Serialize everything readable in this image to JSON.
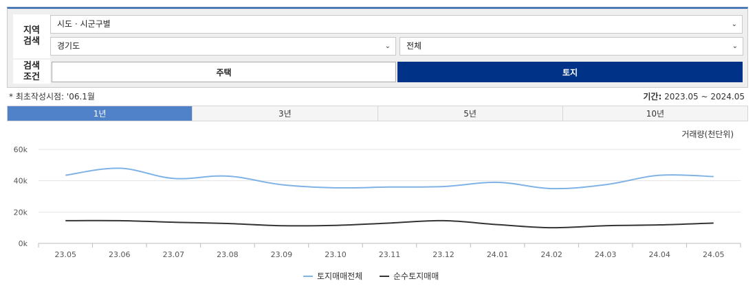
{
  "search": {
    "region_label": "지역\n검색",
    "condition_label": "검색\n조건",
    "mode_select": "시도 · 시군구별",
    "province_select": "경기도",
    "city_select": "전체",
    "btn_house": "주택",
    "btn_land": "토지"
  },
  "info": {
    "note": "* 최초작성시점: '06.1월",
    "period_label": "기간:",
    "period_value": " 2023.05 ~ 2024.05"
  },
  "tabs": [
    {
      "label": "1년",
      "active": true
    },
    {
      "label": "3년",
      "active": false
    },
    {
      "label": "5년",
      "active": false
    },
    {
      "label": "10년",
      "active": false
    }
  ],
  "colors": {
    "accent": "#003388",
    "tab_active": "#4f82c9",
    "series1": "#7fb2e5",
    "series2": "#333333"
  },
  "chart_data": {
    "type": "line",
    "ylabel": "거래량(천단위)",
    "ylim": [
      0,
      60000
    ],
    "y_ticks": [
      0,
      20000,
      40000,
      60000
    ],
    "y_tick_labels": [
      "0k",
      "20k",
      "40k",
      "60k"
    ],
    "categories": [
      "23.05",
      "23.06",
      "23.07",
      "23.08",
      "23.09",
      "23.10",
      "23.11",
      "23.12",
      "24.01",
      "24.02",
      "24.03",
      "24.04",
      "24.05"
    ],
    "series": [
      {
        "name": "토지매매전체",
        "values": [
          43500,
          48000,
          41500,
          43000,
          37500,
          35500,
          36000,
          36300,
          39000,
          35000,
          37500,
          43500,
          42700
        ]
      },
      {
        "name": "순수토지매매",
        "values": [
          14500,
          14500,
          13500,
          12700,
          11300,
          11500,
          13000,
          14500,
          12000,
          10000,
          11300,
          11800,
          13000
        ]
      }
    ],
    "grid": true,
    "legend": "bottom-center"
  }
}
